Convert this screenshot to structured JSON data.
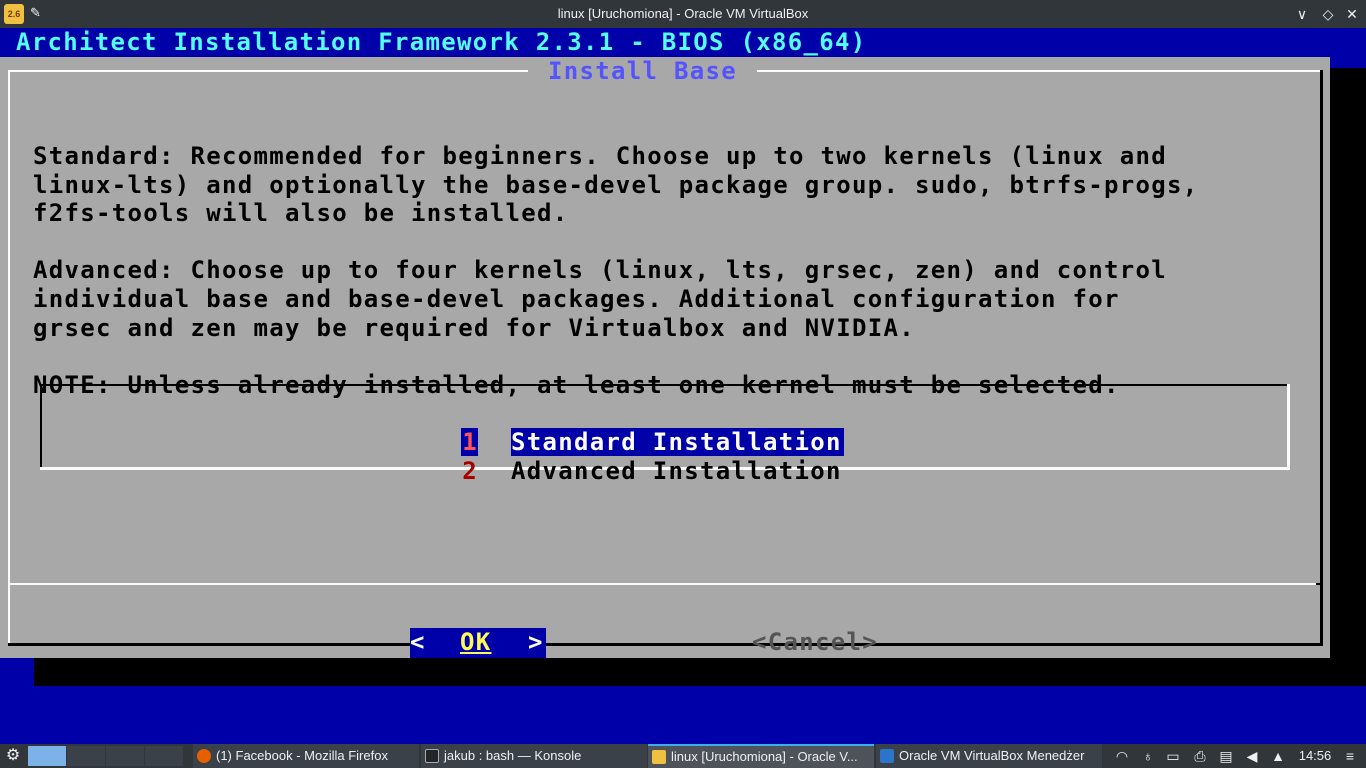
{
  "window": {
    "title": "linux [Uruchomiona] - Oracle VM VirtualBox",
    "icon_label": "2.6",
    "pin_glyph": "✎",
    "buttons": {
      "minimize": "∨",
      "maximize": "◇",
      "close": "✕"
    }
  },
  "vm": {
    "backtitle": "Architect Installation Framework 2.3.1 - BIOS (x86_64)",
    "dialog": {
      "title": "Install Base",
      "standard_lines": [
        "Standard: Recommended for beginners. Choose up to two kernels (linux and",
        "linux-lts) and optionally the base-devel package group. sudo, btrfs-progs,",
        "f2fs-tools will also be installed."
      ],
      "advanced_lines": [
        "Advanced: Choose up to four kernels (linux, lts, grsec, zen) and control",
        "individual base and base-devel packages. Additional configuration for",
        "grsec and zen may be required for Virtualbox and NVIDIA."
      ],
      "note": "NOTE: Unless already installed, at least one kernel must be selected.",
      "menu": [
        {
          "num": "1",
          "label": "Standard Installation",
          "selected": true
        },
        {
          "num": "2",
          "label": "Advanced Installation",
          "selected": false
        }
      ],
      "ok_left": "<",
      "ok_label": "OK",
      "ok_right": ">",
      "cancel_label": "<Cancel>"
    },
    "colors": {
      "background": "#0000a8",
      "dialog": "#a8a8a8",
      "backtitle": "#54fcfc",
      "title": "#5454fc",
      "highlight": "#0000a8",
      "hotkey": "#a80000"
    }
  },
  "taskbar": {
    "tasks": [
      {
        "label": "(1) Facebook - Mozilla Firefox",
        "icon": "firefox-icon"
      },
      {
        "label": "jakub : bash — Konsole",
        "icon": "terminal-icon"
      },
      {
        "label": "linux [Uruchomiona] - Oracle V...",
        "icon": "virtualbox-vm-icon"
      },
      {
        "label": "Oracle VM VirtualBox Menedżer",
        "icon": "virtualbox-icon"
      }
    ],
    "tray_icons": [
      "wifi-icon",
      "bluetooth-icon",
      "battery-icon",
      "printer-icon",
      "clipboard-icon",
      "volume-icon",
      "expand-tray-icon"
    ],
    "clock": "14:56"
  }
}
